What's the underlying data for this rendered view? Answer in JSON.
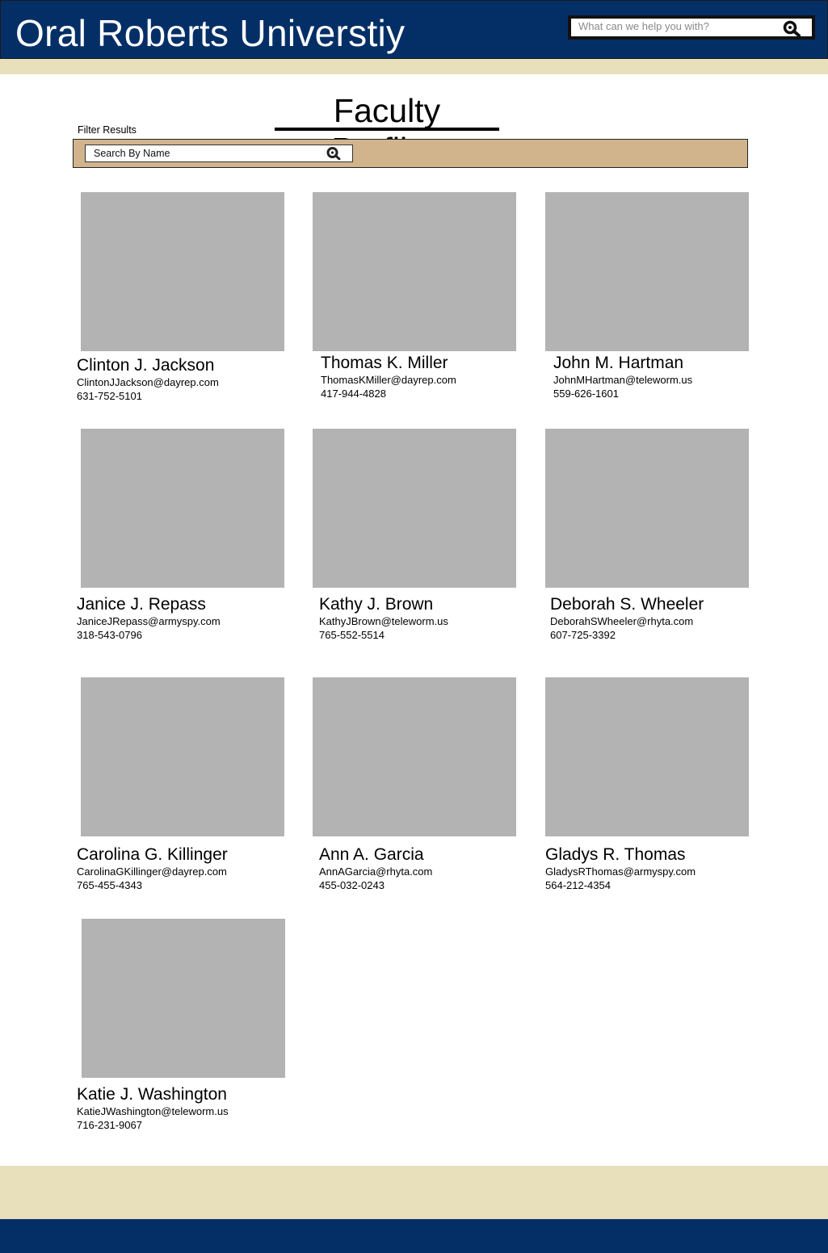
{
  "header": {
    "site_title": "Oral Roberts Universtiy",
    "search_placeholder": "What can we help you with?",
    "search_icon": "search-icon"
  },
  "main": {
    "page_title": "Faculty Profiles",
    "filter_label": "Filter Results",
    "name_search_placeholder": "Search By Name"
  },
  "faculty": [
    {
      "name": "Clinton J. Jackson",
      "email": "ClintonJJackson@dayrep.com",
      "phone": "631-752-5101"
    },
    {
      "name": "Thomas K. Miller",
      "email": "ThomasKMiller@dayrep.com",
      "phone": "417-944-4828"
    },
    {
      "name": "John M. Hartman",
      "email": "JohnMHartman@teleworm.us",
      "phone": "559-626-1601"
    },
    {
      "name": "Janice J. Repass",
      "email": "JaniceJRepass@armyspy.com",
      "phone": "318-543-0796"
    },
    {
      "name": "Kathy J. Brown",
      "email": "KathyJBrown@teleworm.us",
      "phone": "765-552-5514"
    },
    {
      "name": "Deborah S. Wheeler",
      "email": "DeborahSWheeler@rhyta.com",
      "phone": "607-725-3392"
    },
    {
      "name": "Carolina G. Killinger",
      "email": "CarolinaGKillinger@dayrep.com",
      "phone": "765-455-4343"
    },
    {
      "name": "Ann A. Garcia",
      "email": "AnnAGarcia@rhyta.com",
      "phone": "455-032-0243"
    },
    {
      "name": "Gladys R. Thomas",
      "email": "GladysRThomas@armyspy.com",
      "phone": "564-212-4354"
    },
    {
      "name": "Katie J. Washington",
      "email": "KatieJWashington@teleworm.us",
      "phone": "716-231-9067"
    }
  ],
  "colors": {
    "header_blue": "#042f66",
    "cream": "#e8e0bb",
    "filter_tan": "#d2b48c",
    "photo_placeholder": "#b3b3b3"
  }
}
